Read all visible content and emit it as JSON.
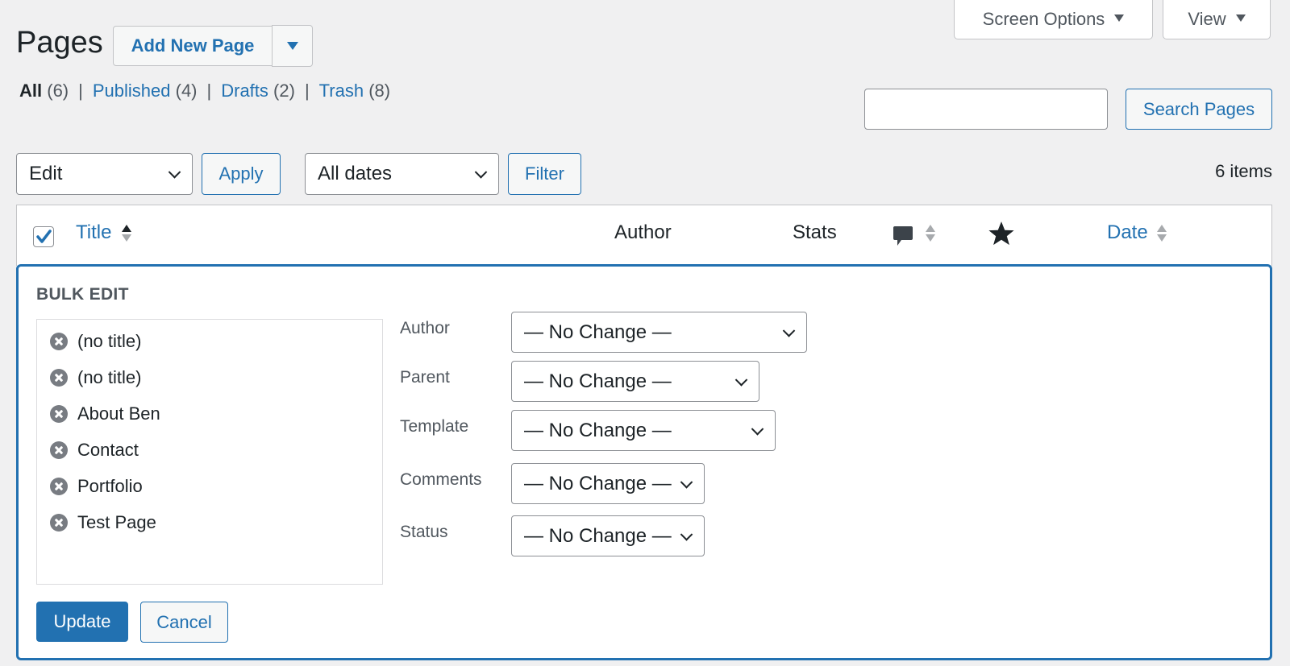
{
  "screen_meta": {
    "screen_options_label": "Screen Options",
    "view_label": "View"
  },
  "header": {
    "title": "Pages",
    "add_new_label": "Add New Page"
  },
  "status_filters": [
    {
      "label": "All",
      "count": "(6)",
      "current": true
    },
    {
      "label": "Published",
      "count": "(4)",
      "current": false
    },
    {
      "label": "Drafts",
      "count": "(2)",
      "current": false
    },
    {
      "label": "Trash",
      "count": "(8)",
      "current": false
    }
  ],
  "search": {
    "value": "",
    "button_label": "Search Pages"
  },
  "tablenav": {
    "bulk_action_selected": "Edit",
    "apply_label": "Apply",
    "date_filter_selected": "All dates",
    "filter_label": "Filter",
    "items_count": "6 items"
  },
  "table": {
    "select_all_checked": true,
    "columns": {
      "title": "Title",
      "author": "Author",
      "stats": "Stats",
      "comments_icon": "comment-icon",
      "likes_icon": "star-icon",
      "date": "Date"
    }
  },
  "bulk_edit": {
    "heading": "BULK EDIT",
    "titles": [
      "(no title)",
      "(no title)",
      "About Ben",
      "Contact",
      "Portfolio",
      "Test Page"
    ],
    "fields": [
      {
        "label": "Author",
        "value": "— No Change —"
      },
      {
        "label": "Parent",
        "value": "— No Change —"
      },
      {
        "label": "Template",
        "value": "— No Change —"
      },
      {
        "label": "Comments",
        "value": "— No Change —"
      },
      {
        "label": "Status",
        "value": "— No Change —"
      }
    ],
    "update_label": "Update",
    "cancel_label": "Cancel"
  },
  "colors": {
    "accent": "#2271b1",
    "background": "#f0f0f1",
    "text": "#1d2327"
  }
}
